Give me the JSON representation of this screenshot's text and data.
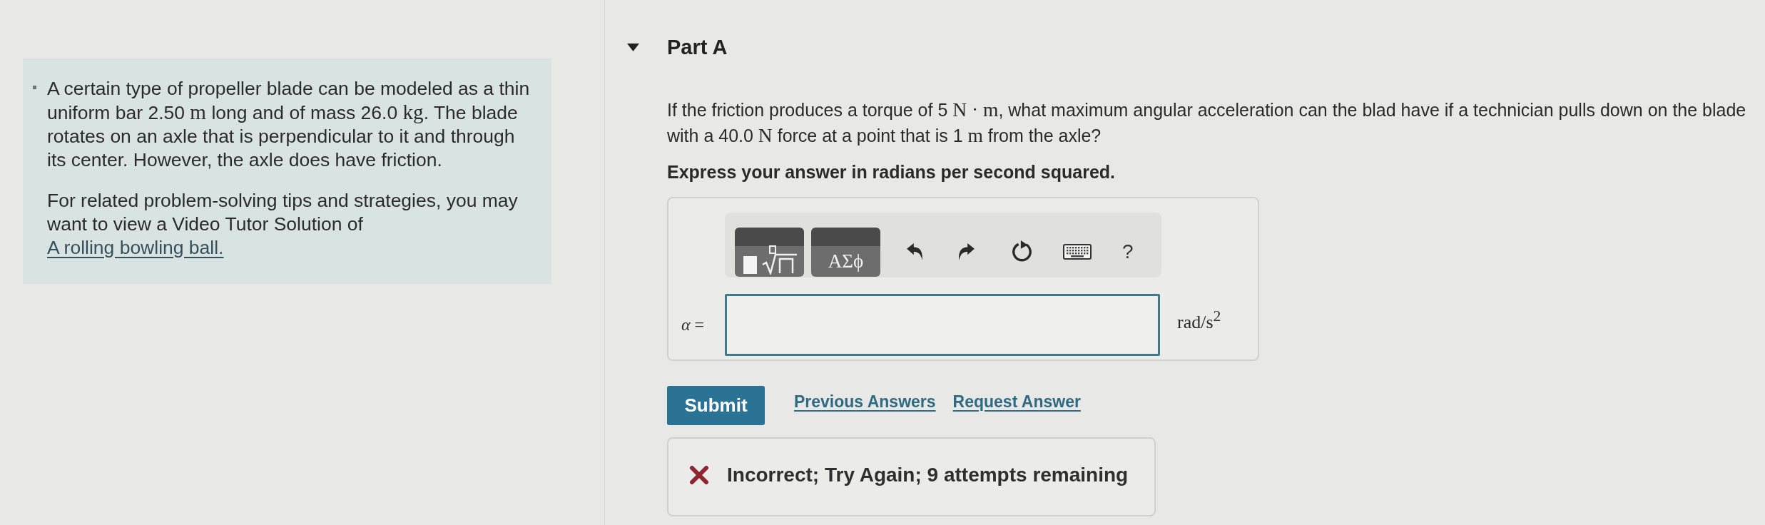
{
  "problem": {
    "paragraphs": [
      {
        "segments": [
          {
            "kind": "text",
            "text": "A certain type of propeller blade can be modeled as a thin uniform bar 2.50 "
          },
          {
            "kind": "math",
            "text": "m"
          },
          {
            "kind": "text",
            "text": " long and of mass 26.0 "
          },
          {
            "kind": "math",
            "text": "kg"
          },
          {
            "kind": "text",
            "text": ". The blade rotates on an axle that is perpendicular to it and through its center. However, the axle does have friction."
          }
        ]
      },
      {
        "segments": [
          {
            "kind": "text",
            "text": "For related problem-solving tips and strategies, you may want to view a Video Tutor Solution of "
          },
          {
            "kind": "link",
            "text": "A rolling bowling ball."
          }
        ]
      }
    ]
  },
  "part": {
    "title": "Part A",
    "expanded": true,
    "question": [
      {
        "kind": "text",
        "text": "If the friction produces a torque of 5 "
      },
      {
        "kind": "math",
        "text": "N · m"
      },
      {
        "kind": "text",
        "text": ", what maximum angular acceleration can the blad have if a technician pulls down on the blade with a 40.0 "
      },
      {
        "kind": "math",
        "text": "N"
      },
      {
        "kind": "text",
        "text": " force at a point that is 1 "
      },
      {
        "kind": "math",
        "text": "m"
      },
      {
        "kind": "text",
        "text": " from the axle?"
      }
    ],
    "instruction": "Express your answer in radians per second squared.",
    "toolbar": [
      {
        "kind": "templates"
      },
      {
        "kind": "symbols",
        "label": "ΑΣϕ"
      },
      {
        "kind": "undo"
      },
      {
        "kind": "redo"
      },
      {
        "kind": "reset"
      },
      {
        "kind": "keyboard"
      },
      {
        "kind": "help",
        "label": "?"
      }
    ],
    "answer": {
      "label": "*α* =",
      "unit": "rad/s$^{2}$"
    },
    "actions": [
      {
        "kind": "submit",
        "label": "Submit"
      },
      {
        "kind": "link",
        "label": "Previous Answers"
      },
      {
        "kind": "link",
        "label": "Request Answer"
      }
    ],
    "feedback": {
      "kind": "incorrect",
      "text": "Incorrect; Try Again; 9 attempts remaining"
    }
  }
}
